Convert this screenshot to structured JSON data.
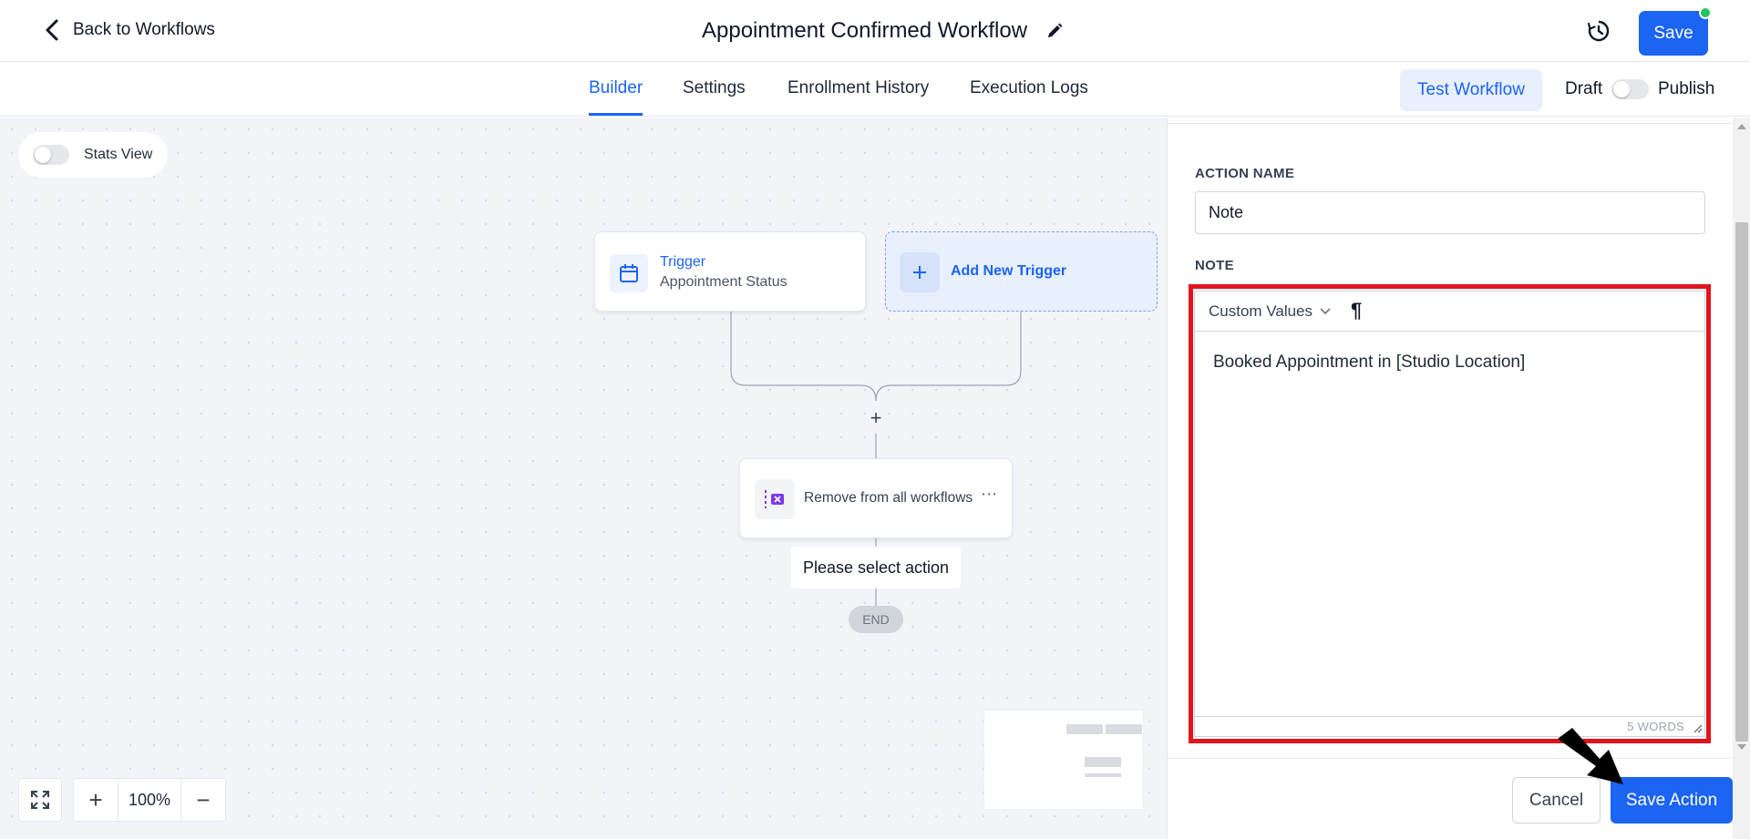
{
  "header": {
    "back_label": "Back to Workflows",
    "title": "Appointment Confirmed Workflow",
    "save_label": "Save"
  },
  "tabs": [
    {
      "label": "Builder",
      "active": true
    },
    {
      "label": "Settings",
      "active": false
    },
    {
      "label": "Enrollment History",
      "active": false
    },
    {
      "label": "Execution Logs",
      "active": false
    }
  ],
  "toolbar": {
    "test_label": "Test Workflow",
    "draft_label": "Draft",
    "publish_label": "Publish",
    "published": false
  },
  "canvas": {
    "stats_label": "Stats View",
    "stats_enabled": false,
    "trigger": {
      "title": "Trigger",
      "subtitle": "Appointment Status"
    },
    "add_trigger_label": "Add New Trigger",
    "action_label": "Remove from all workflows",
    "action_hint": "Please select action",
    "end_label": "END",
    "zoom": "100%"
  },
  "panel": {
    "action_name_label": "ACTION NAME",
    "action_name_value": "Note",
    "note_label": "NOTE",
    "custom_values_label": "Custom Values",
    "note_text": "Booked Appointment in [Studio Location]",
    "word_count": "5 WORDS",
    "cancel_label": "Cancel",
    "save_action_label": "Save Action"
  },
  "colors": {
    "accent": "#1c64f2",
    "highlight": "#e1141e",
    "status_dot": "#22c55e",
    "action_icon": "#7c3aed"
  }
}
